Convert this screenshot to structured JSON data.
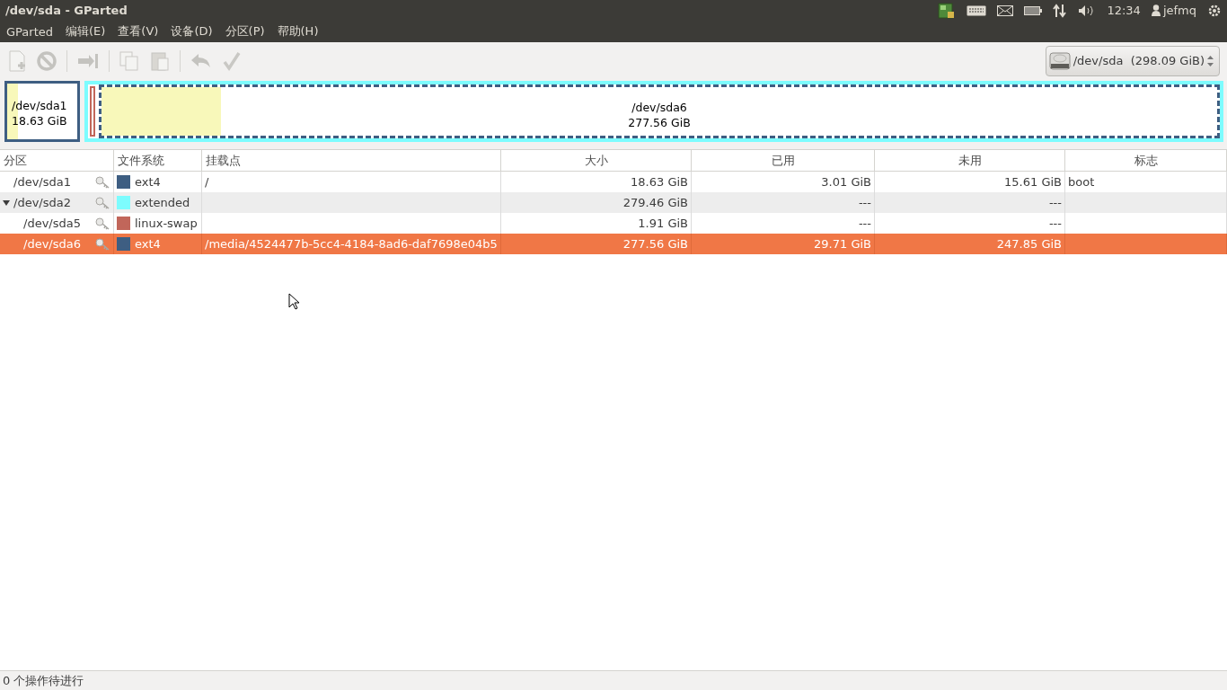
{
  "window": {
    "title": "/dev/sda - GParted"
  },
  "top_panel": {
    "clock": "12:34",
    "user": "jefmq"
  },
  "menu": [
    "GParted",
    "编辑(E)",
    "查看(V)",
    "设备(D)",
    "分区(P)",
    "帮助(H)"
  ],
  "device_selector": {
    "device": "/dev/sda",
    "size": "(298.09 GiB)"
  },
  "partition_map": [
    {
      "kind": "primary",
      "name": "/dev/sda1",
      "size": "18.63 GiB",
      "color": "#3e5e82",
      "level": 0.16,
      "selected": false
    },
    {
      "kind": "extended",
      "color": "#7dfcfe",
      "children": [
        {
          "kind": "swap",
          "color": "#c1665a",
          "selected": false
        },
        {
          "kind": "logical",
          "name": "/dev/sda6",
          "size": "277.56 GiB",
          "color": "#3e5e82",
          "level": 0.107,
          "selected": true
        }
      ]
    }
  ],
  "table": {
    "columns": [
      "分区",
      "文件系统",
      "挂载点",
      "大小",
      "已用",
      "未用",
      "标志"
    ],
    "rows": [
      {
        "partition": "/dev/sda1",
        "filesystem": "ext4",
        "color": "#3e5e82",
        "mount": "/",
        "size": "18.63 GiB",
        "used": "3.01 GiB",
        "unused": "15.61 GiB",
        "flags": "boot",
        "selected": false
      },
      {
        "partition": "/dev/sda2",
        "filesystem": "extended",
        "color": "#7dfcfe",
        "size": "279.46 GiB",
        "used": "---",
        "unused": "---",
        "selected": false,
        "expanded": true,
        "children": [
          {
            "partition": "/dev/sda5",
            "filesystem": "linux-swap",
            "color": "#c1665a",
            "size": "1.91 GiB",
            "used": "---",
            "unused": "---",
            "selected": false
          },
          {
            "partition": "/dev/sda6",
            "filesystem": "ext4",
            "color": "#3e5e82",
            "mount": "/media/4524477b-5cc4-4184-8ad6-daf7698e04b5",
            "size": "277.56 GiB",
            "used": "29.71 GiB",
            "unused": "247.85 GiB",
            "selected": true
          }
        ]
      }
    ]
  },
  "status_bar": "0 个操作待进行"
}
